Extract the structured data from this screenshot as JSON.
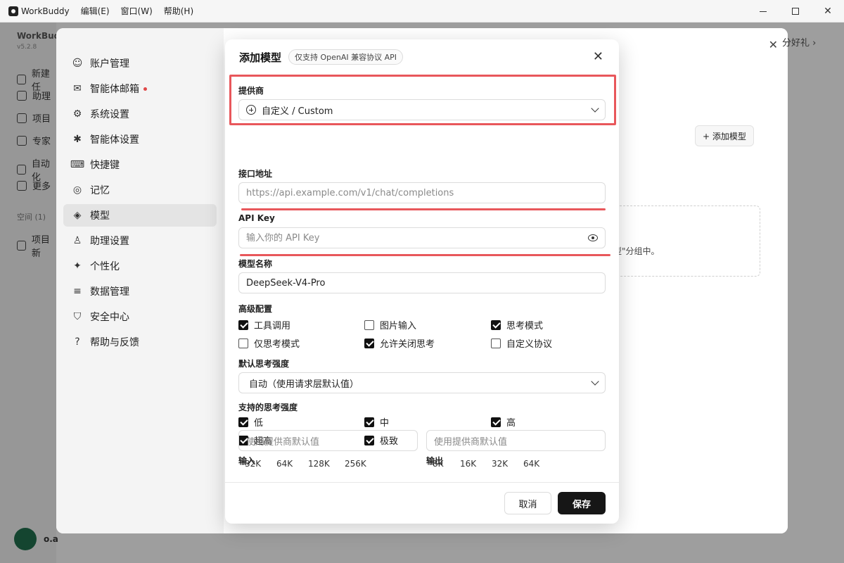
{
  "window": {
    "app_name": "WorkBuddy",
    "menus": [
      "编辑(E)",
      "窗口(W)",
      "帮助(H)"
    ]
  },
  "rail": {
    "app_name": "WorkBudd",
    "version": "v5.2.8",
    "items": [
      {
        "label": "新建任",
        "icon": "plus-circle-icon"
      },
      {
        "label": "助理",
        "icon": "assistant-icon"
      },
      {
        "label": "项目",
        "icon": "project-icon"
      },
      {
        "label": "专家",
        "icon": "expert-icon"
      },
      {
        "label": "自动化",
        "icon": "automation-icon"
      },
      {
        "label": "更多",
        "icon": "more-icon"
      },
      {
        "label": "空间 (1)",
        "icon": "space-icon"
      },
      {
        "label": "项目新",
        "icon": "project-add-icon"
      }
    ],
    "user_name": "o.a"
  },
  "settings_nav": [
    {
      "label": "账户管理",
      "icon": "user-icon",
      "glyph": "☺"
    },
    {
      "label": "智能体邮箱",
      "icon": "mail-icon",
      "glyph": "✉",
      "dot": true
    },
    {
      "label": "系统设置",
      "icon": "gear-icon",
      "glyph": "⚙"
    },
    {
      "label": "智能体设置",
      "icon": "puzzle-icon",
      "glyph": "✱"
    },
    {
      "label": "快捷键",
      "icon": "keyboard-icon",
      "glyph": "⌨"
    },
    {
      "label": "记忆",
      "icon": "memory-icon",
      "glyph": "◎"
    },
    {
      "label": "模型",
      "icon": "cube-icon",
      "glyph": "◈",
      "active": true
    },
    {
      "label": "助理设置",
      "icon": "assistant-settings-icon",
      "glyph": "♙"
    },
    {
      "label": "个性化",
      "icon": "sparkle-icon",
      "glyph": "✦"
    },
    {
      "label": "数据管理",
      "icon": "database-icon",
      "glyph": "≡"
    },
    {
      "label": "安全中心",
      "icon": "shield-icon",
      "glyph": "⛉"
    },
    {
      "label": "帮助与反馈",
      "icon": "help-icon",
      "glyph": "?"
    }
  ],
  "background": {
    "gift_text": "分好礼",
    "add_model_btn": "+ 添加模型",
    "hint_text": "型\"分组中。"
  },
  "dialog": {
    "title": "添加模型",
    "badge": "仅支持 OpenAI 兼容协议 API",
    "provider": {
      "label": "提供商",
      "value": "自定义 / Custom"
    },
    "endpoint": {
      "label": "接口地址",
      "placeholder": "https://api.example.com/v1/chat/completions"
    },
    "api_key": {
      "label": "API Key",
      "placeholder": "输入你的 API Key"
    },
    "model_name": {
      "label": "模型名称",
      "value": "DeepSeek-V4-Pro"
    },
    "advanced": {
      "label": "高级配置",
      "options": [
        {
          "label": "工具调用",
          "checked": true
        },
        {
          "label": "图片输入",
          "checked": false
        },
        {
          "label": "思考模式",
          "checked": true
        },
        {
          "label": "仅思考模式",
          "checked": false
        },
        {
          "label": "允许关闭思考",
          "checked": true
        },
        {
          "label": "自定义协议",
          "checked": false
        }
      ]
    },
    "default_effort": {
      "label": "默认思考强度",
      "value": "自动（使用请求层默认值）"
    },
    "supported_effort": {
      "label": "支持的思考强度",
      "options": [
        {
          "label": "低",
          "checked": true
        },
        {
          "label": "中",
          "checked": true
        },
        {
          "label": "高",
          "checked": true
        },
        {
          "label": "超高",
          "checked": true
        },
        {
          "label": "极致",
          "checked": true
        }
      ]
    },
    "input": {
      "label": "输入",
      "placeholder": "使用提供商默认值",
      "presets": [
        "32K",
        "64K",
        "128K",
        "256K"
      ]
    },
    "output": {
      "label": "输出",
      "placeholder": "使用提供商默认值",
      "presets": [
        "8K",
        "16K",
        "32K",
        "64K"
      ]
    },
    "cancel_label": "取消",
    "save_label": "保存"
  },
  "colors": {
    "highlight": "#e8575b",
    "primary_btn": "#161616"
  }
}
